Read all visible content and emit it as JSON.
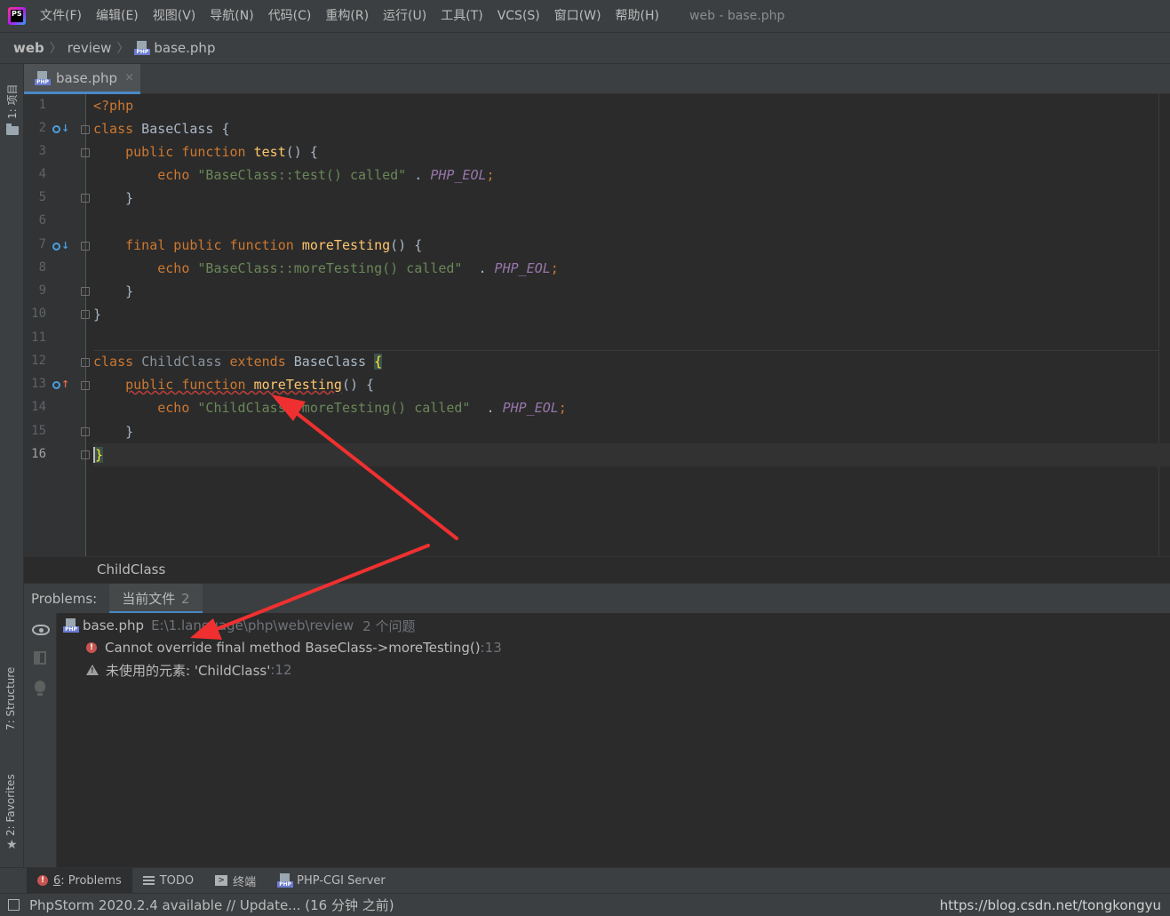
{
  "app": {
    "logo_text": "PS"
  },
  "menu": {
    "items": [
      "文件(F)",
      "编辑(E)",
      "视图(V)",
      "导航(N)",
      "代码(C)",
      "重构(R)",
      "运行(U)",
      "工具(T)",
      "VCS(S)",
      "窗口(W)",
      "帮助(H)"
    ],
    "window_title": "web - base.php"
  },
  "breadcrumb": {
    "items": [
      "web",
      "review",
      "base.php"
    ]
  },
  "left_stripe": {
    "project_label": "1: 项目",
    "structure_label": "7: Structure",
    "favorites_label": "2: Favorites"
  },
  "editor": {
    "tab": {
      "label": "base.php",
      "close": "×"
    },
    "line_numbers": [
      "1",
      "2",
      "3",
      "4",
      "5",
      "6",
      "7",
      "8",
      "9",
      "10",
      "11",
      "12",
      "13",
      "14",
      "15",
      "16"
    ],
    "current_line": 16,
    "footer_breadcrumb": "ChildClass"
  },
  "problems": {
    "title": "Problems:",
    "tab_label": "当前文件",
    "tab_count": "2",
    "file": {
      "name": "base.php",
      "path": "E:\\1.language\\php\\web\\review",
      "count": "2 个问题"
    },
    "items": [
      {
        "severity": "error",
        "message": "Cannot override final method BaseClass->moreTesting()",
        "line": ":13"
      },
      {
        "severity": "warning",
        "message": "未使用的元素: 'ChildClass'",
        "line": ":12"
      }
    ]
  },
  "bottom_tabs": [
    {
      "label_prefix": "6",
      "label": ": Problems",
      "icon": "error-icon"
    },
    {
      "label": "TODO",
      "icon": "todo-icon"
    },
    {
      "label": "终端",
      "icon": "terminal-icon"
    },
    {
      "label": "PHP-CGI Server",
      "icon": "php-icon"
    }
  ],
  "status": {
    "text": "PhpStorm 2020.2.4 available // Update... (16 分钟 之前)",
    "watermark": "https://blog.csdn.net/tongkongyu"
  },
  "colors": {
    "keyword": "#cc7832",
    "function": "#ffc66d",
    "string": "#6a8759",
    "constant": "#9876aa",
    "annotation_arrow": "#f03030"
  }
}
